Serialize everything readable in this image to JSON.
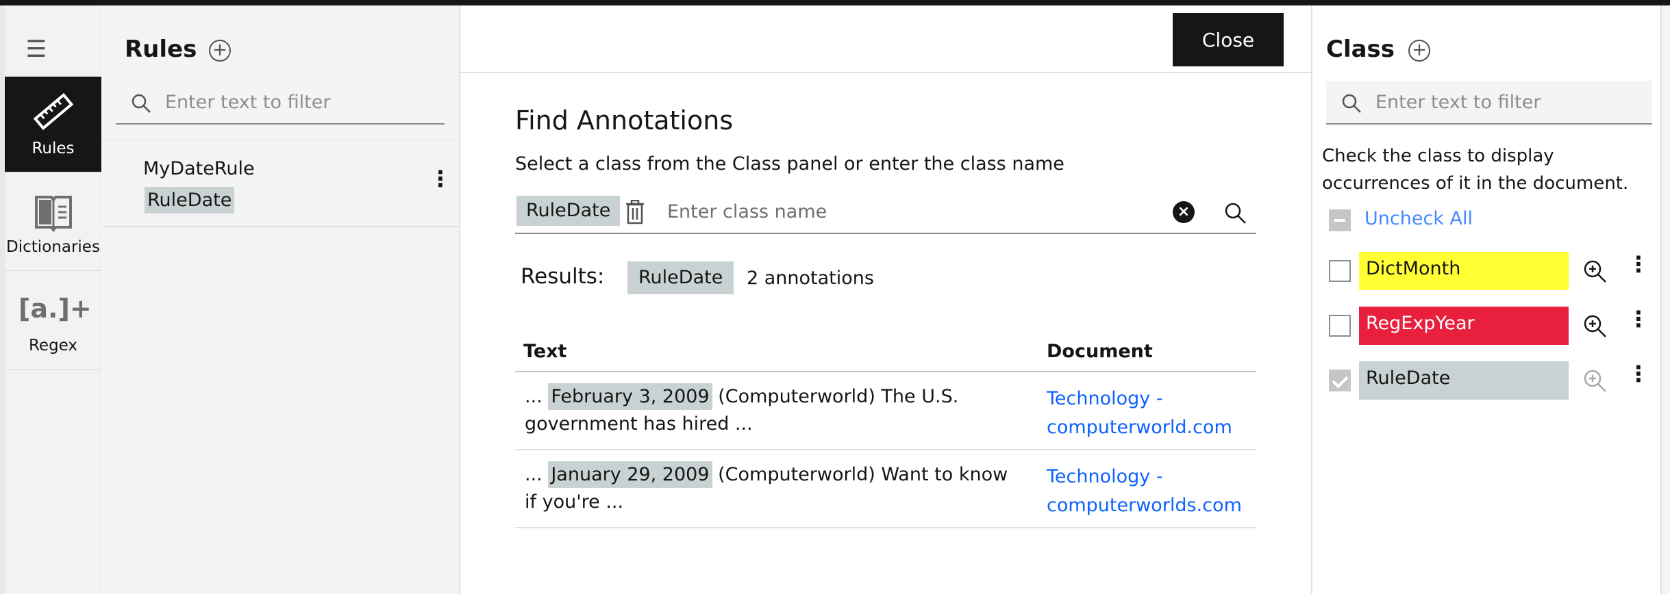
{
  "rail": {
    "items": [
      {
        "label": "Rules",
        "icon": "ruler-icon",
        "active": true
      },
      {
        "label": "Dictionaries",
        "icon": "book-icon",
        "active": false
      },
      {
        "label": "Regex",
        "icon": "regex-icon",
        "active": false
      }
    ],
    "regex_glyph": "[a.]+"
  },
  "rules_panel": {
    "title": "Rules",
    "search_placeholder": "Enter text to filter",
    "rules": [
      {
        "name": "MyDateRule"
      },
      {
        "name": "RuleDate"
      }
    ]
  },
  "main": {
    "close_label": "Close",
    "title": "Find Annotations",
    "subtitle": "Select a class from the Class panel or enter the class name",
    "selected_class": "RuleDate",
    "class_input_placeholder": "Enter class name",
    "results_label": "Results:",
    "results_class": "RuleDate",
    "results_count": "2 annotations",
    "table": {
      "headers": [
        "Text",
        "Document"
      ],
      "rows": [
        {
          "prefix": "...",
          "highlight": "February 3, 2009",
          "suffix": "(Computerworld) The U.S. government has hired ...",
          "document": "Technology - computerworld.com"
        },
        {
          "prefix": "...",
          "highlight": "January 29, 2009",
          "suffix": "(Computerworld) Want to know if you're ...",
          "document": "Technology - computerworlds.com"
        }
      ]
    }
  },
  "class_panel": {
    "title": "Class",
    "search_placeholder": "Enter text to filter",
    "description": "Check the class to display occurrences of it in the document.",
    "uncheck_all_label": "Uncheck All",
    "classes": [
      {
        "name": "DictMonth",
        "color": "#ffff33",
        "text_color": "#161616",
        "checked": false
      },
      {
        "name": "RegExpYear",
        "color": "#e8203e",
        "text_color": "#ffffff",
        "checked": false
      },
      {
        "name": "RuleDate",
        "color": "#c9d2d2",
        "text_color": "#161616",
        "checked": true
      }
    ]
  }
}
